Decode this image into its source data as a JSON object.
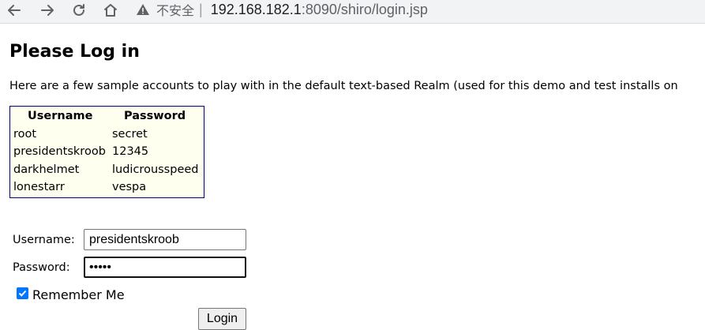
{
  "browser": {
    "security_label": "不安全",
    "separator": "|",
    "url_host": "192.168.182.1",
    "url_rest": ":8090/shiro/login.jsp"
  },
  "page": {
    "title": "Please Log in",
    "intro": "Here are a few sample accounts to play with in the default text-based Realm (used for this demo and test installs on"
  },
  "accounts": {
    "headers": [
      "Username",
      "Password"
    ],
    "rows": [
      [
        "root",
        "secret"
      ],
      [
        "presidentskroob",
        "12345"
      ],
      [
        "darkhelmet",
        "ludicrousspeed"
      ],
      [
        "lonestarr",
        "vespa"
      ]
    ]
  },
  "form": {
    "username_label": "Username:",
    "username_value": "presidentskroob",
    "password_label": "Password:",
    "password_value": "•••••",
    "remember_label": "Remember Me",
    "remember_checked": true,
    "login_label": "Login"
  },
  "colors": {
    "table_border": "#00008b",
    "table_bg": "#fffff0",
    "checkbox_accent": "#0075ff"
  }
}
